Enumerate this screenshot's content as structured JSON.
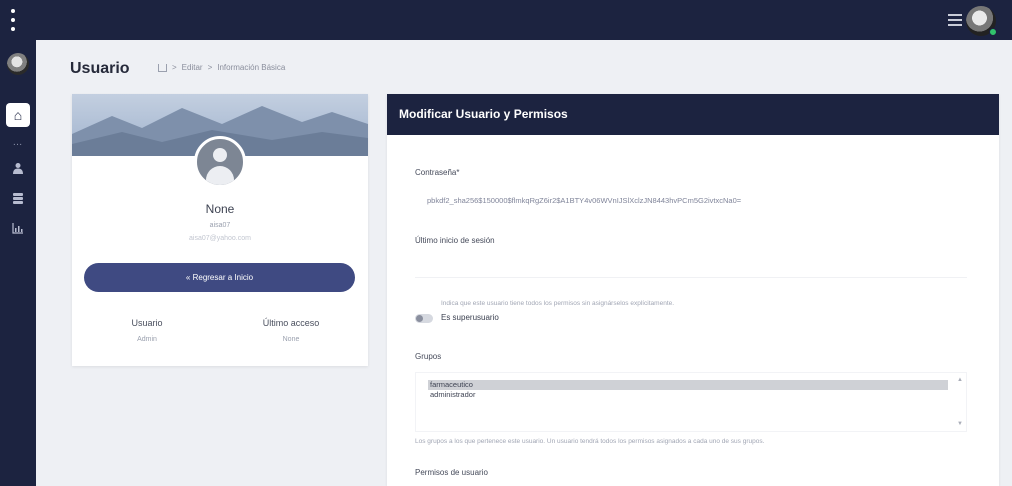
{
  "page": {
    "title": "Usuario",
    "breadcrumb": [
      "Editar",
      "Información Básica"
    ]
  },
  "icons": {
    "topbar_menu": "kebab-icon",
    "topbar_list": "list-icon",
    "sidebar": [
      "home-icon",
      "user-icon",
      "database-icon",
      "chart-icon"
    ]
  },
  "colors": {
    "navy": "#1c2340",
    "button": "#3f4a82",
    "background": "#eef0f4"
  },
  "profile": {
    "name": "None",
    "username": "aisa07",
    "email": "aisa07@yahoo.com",
    "back_button": "« Regresar a Inicio",
    "stats": [
      {
        "label": "Usuario",
        "value": "Admin"
      },
      {
        "label": "Último acceso",
        "value": "None"
      }
    ]
  },
  "form": {
    "header": "Modificar Usuario y Permisos",
    "password_label": "Contraseña*",
    "password_value": "pbkdf2_sha256$150000$flmkqRgZ6ir2$A1BTY4v06WVnIJSlXclzJN8443hvPCm5G2ivtxcNa0=",
    "last_login_label": "Último inicio de sesión",
    "superuser_help": "Indica que este usuario tiene todos los permisos sin asignárselos explícitamente.",
    "superuser_label": "Es superusuario",
    "groups_label": "Grupos",
    "groups_options": [
      "farmaceutico",
      "administrador"
    ],
    "groups_selected": "farmaceutico",
    "groups_help": "Los grupos a los que pertenece este usuario. Un usuario tendrá todos los permisos asignados a cada uno de sus grupos.",
    "permissions_label": "Permisos de usuario"
  }
}
